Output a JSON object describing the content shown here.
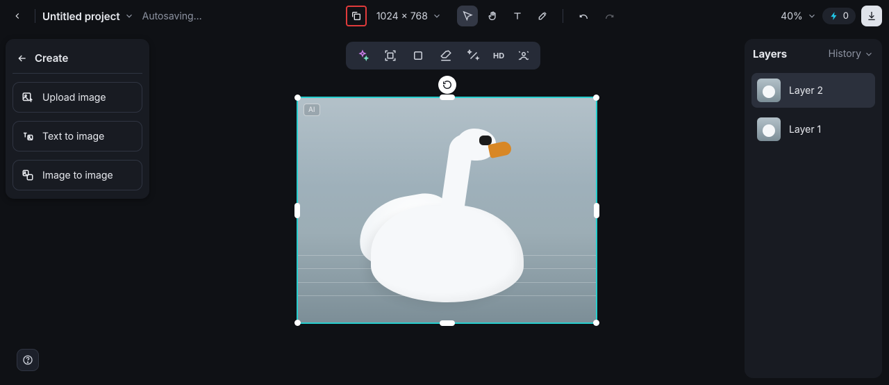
{
  "header": {
    "project_title": "Untitled project",
    "save_status": "Autosaving...",
    "canvas_dimensions": "1024 × 768",
    "zoom": "40%",
    "credits": "0"
  },
  "sidebar": {
    "create_label": "Create",
    "actions": [
      {
        "label": "Upload image"
      },
      {
        "label": "Text to image"
      },
      {
        "label": "Image to image"
      }
    ]
  },
  "canvas": {
    "ai_badge": "AI"
  },
  "ctx_toolbar": {
    "hd_label": "HD"
  },
  "right": {
    "tab_layers": "Layers",
    "tab_history": "History",
    "layers": [
      {
        "name": "Layer 2",
        "active": true
      },
      {
        "name": "Layer 1",
        "active": false
      }
    ]
  }
}
